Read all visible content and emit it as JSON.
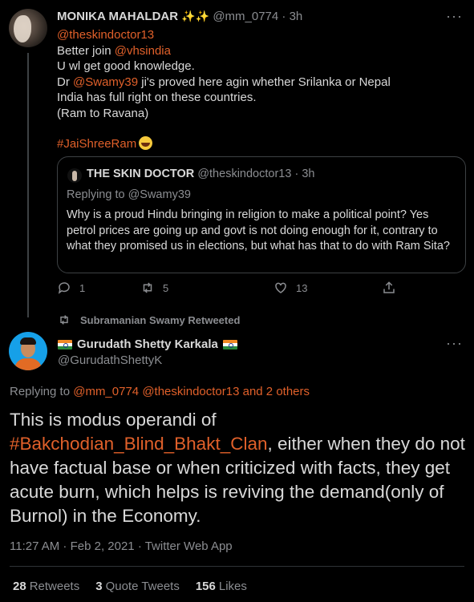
{
  "reply": {
    "author_name": "MONIKA MAHALDAR",
    "sparkles": "✨✨",
    "author_handle": "@mm_0774",
    "time": "3h",
    "more": "···",
    "body": {
      "mention1": "@theskindoctor13",
      "line2_prefix": "Better join ",
      "mention2": "@vhsindia",
      "line3": "U wl get good knowledge.",
      "line4_prefix": "Dr ",
      "mention3": "@Swamy39",
      "line4_suffix": " ji's proved here agin whether Srilanka or Nepal",
      "line5": "India has full right on these countries.",
      "line6": "(Ram to Ravana)",
      "hashtag": "#JaiShreeRam"
    },
    "quote": {
      "author_name": "THE SKIN DOCTOR",
      "author_handle": "@theskindoctor13",
      "time": "3h",
      "replying": "Replying to @Swamy39",
      "text": "Why is a proud Hindu bringing in religion to make a political point? Yes petrol prices are going up and govt is not doing enough for it, contrary to what they promised us in elections, but what has that to do with Ram Sita?"
    },
    "actions": {
      "replies": "1",
      "retweets": "5",
      "likes": "13"
    }
  },
  "retweet_banner": "Subramanian Swamy Retweeted",
  "main": {
    "author_name": "Gurudath Shetty Karkala",
    "author_handle": "@GurudathShettyK",
    "more": "···",
    "replying_prefix": "Replying to ",
    "replying_mentions": "@mm_0774 @theskindoctor13 and 2 others",
    "text_line1": "This is modus operandi of",
    "hashtag": "#Bakchodian_Blind_Bhakt_Clan",
    "text_rest": ", either when they do not have factual base or when criticized with facts, they get acute burn, which helps is reviving the demand(only of Burnol) in the Economy.",
    "timestamp": "11:27 AM · Feb 2, 2021 · Twitter Web App",
    "stats": {
      "retweets_count": "28",
      "retweets_label": "Retweets",
      "quotes_count": "3",
      "quotes_label": "Quote Tweets",
      "likes_count": "156",
      "likes_label": "Likes"
    }
  },
  "colors": {
    "background": "#000000",
    "accent": "#e0602a",
    "muted": "#8b8d91",
    "text": "#d9d9d9",
    "border": "#3d4144"
  }
}
